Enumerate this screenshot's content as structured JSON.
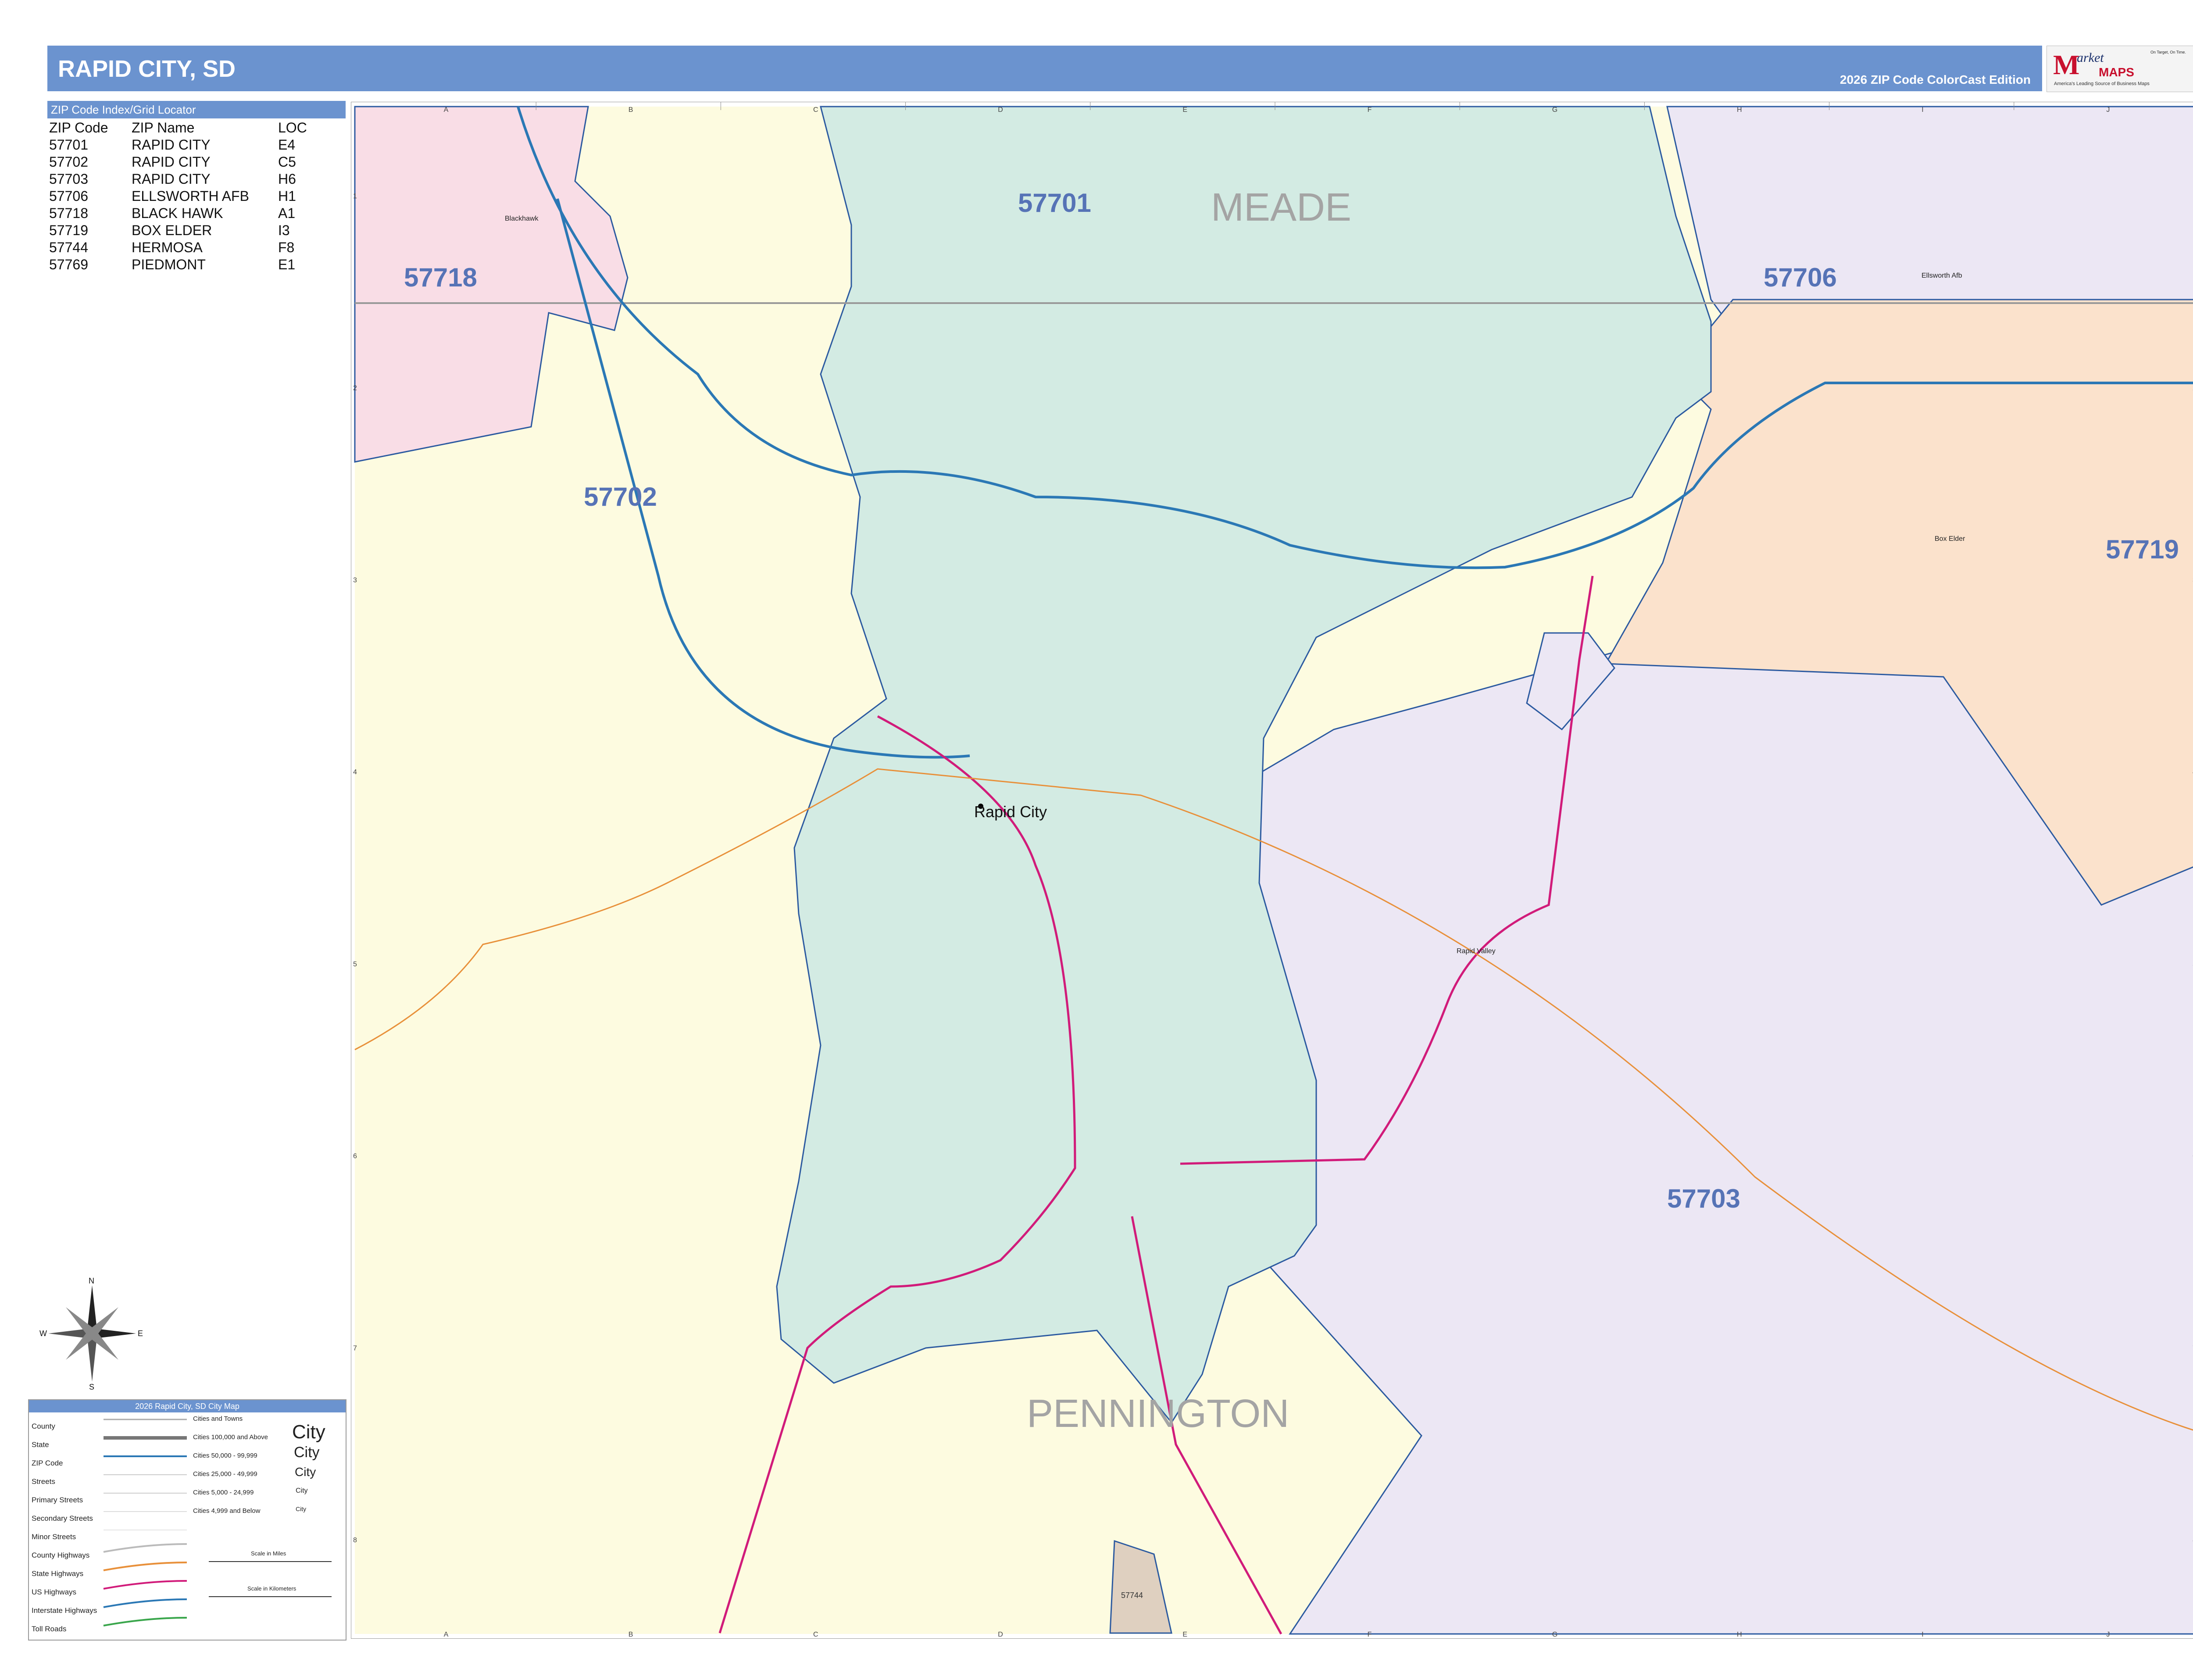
{
  "title": "RAPID CITY, SD",
  "edition": "2026 ZIP Code ColorCast Edition",
  "logo": {
    "brand_initial": "M",
    "brand_rest": "arket",
    "brand_maps": "MAPS",
    "tagline": "America's Leading Source of Business Maps",
    "slogan": "On Target, On Time."
  },
  "index": {
    "header": "ZIP Code Index/Grid Locator",
    "columns": [
      "ZIP Code",
      "ZIP Name",
      "LOC"
    ],
    "rows": [
      [
        "57701",
        "RAPID CITY",
        "E4"
      ],
      [
        "57702",
        "RAPID CITY",
        "C5"
      ],
      [
        "57703",
        "RAPID CITY",
        "H6"
      ],
      [
        "57706",
        "ELLSWORTH AFB",
        "H1"
      ],
      [
        "57718",
        "BLACK HAWK",
        "A1"
      ],
      [
        "57719",
        "BOX ELDER",
        "I3"
      ],
      [
        "57744",
        "HERMOSA",
        "F8"
      ],
      [
        "57769",
        "PIEDMONT",
        "E1"
      ]
    ]
  },
  "map": {
    "colors": {
      "zip_57701": "#d3ebe3",
      "zip_57702": "#fdfbe0",
      "zip_57703": "#ece7f4",
      "zip_57706": "#ece7f4",
      "zip_57718": "#f9dde6",
      "zip_57719": "#fbe2cc",
      "zip_57744": "#dfd0c0",
      "zip_boundary": "#2c5aa0",
      "interstate": "#2b78b5",
      "us_highway": "#d11b7a",
      "state_highway": "#e8903a",
      "county_line": "#999999",
      "zip_label": "#5673b6",
      "county_label": "#a4a4a4"
    },
    "zip_labels": [
      "57701",
      "57702",
      "57703",
      "57706",
      "57718",
      "57719",
      "57744"
    ],
    "county_labels": [
      "MEADE",
      "PENNINGTON"
    ],
    "city_labels": {
      "rapid_city": "Rapid City",
      "rapid_valley": "Rapid Valley",
      "box_elder": "Box Elder",
      "ellsworth": "Ellsworth Afb",
      "blackhawk": "Blackhawk"
    },
    "grid_columns": [
      "A",
      "B",
      "C",
      "D",
      "E",
      "F",
      "G",
      "H",
      "I",
      "J"
    ],
    "grid_rows": [
      "1",
      "2",
      "3",
      "4",
      "5",
      "6",
      "7",
      "8"
    ]
  },
  "compass": {
    "n": "N",
    "s": "S",
    "e": "E",
    "w": "W"
  },
  "legend": {
    "header": "2026 Rapid City, SD City Map",
    "items": [
      "County",
      "State",
      "ZIP Code",
      "Streets",
      "Primary Streets",
      "Secondary Streets",
      "Minor Streets",
      "County Highways",
      "State Highways",
      "US Highways",
      "Interstate Highways",
      "Toll Roads"
    ],
    "city_classes": [
      "Cities and Towns",
      "Cities 100,000 and Above",
      "Cities 50,000 - 99,999",
      "Cities 25,000 - 49,999",
      "Cities 5,000 - 24,999",
      "Cities 4,999 and Below"
    ],
    "city_samples": [
      "City",
      "City",
      "City",
      "City",
      "City"
    ],
    "scale_miles": "Scale in Miles",
    "scale_km": "Scale in Kilometers"
  }
}
